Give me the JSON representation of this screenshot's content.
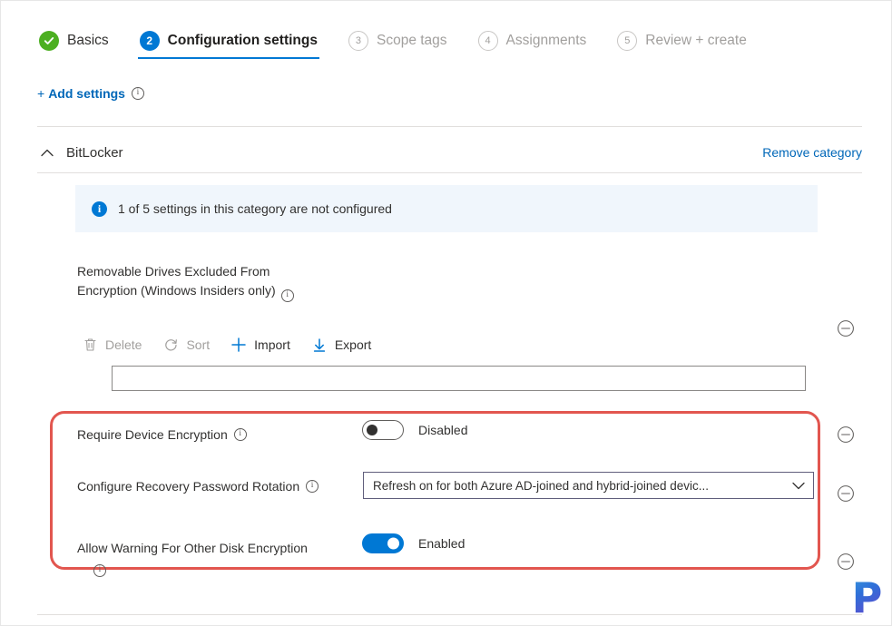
{
  "wizard": {
    "steps": [
      {
        "badge": "check",
        "label": "Basics",
        "state": "done"
      },
      {
        "badge": "2",
        "label": "Configuration settings",
        "state": "active"
      },
      {
        "badge": "3",
        "label": "Scope tags",
        "state": "pending"
      },
      {
        "badge": "4",
        "label": "Assignments",
        "state": "pending"
      },
      {
        "badge": "5",
        "label": "Review + create",
        "state": "pending"
      }
    ]
  },
  "toolbar": {
    "add_settings_plus": "+",
    "add_settings_label": "Add settings"
  },
  "category": {
    "title": "BitLocker",
    "remove_label": "Remove category",
    "banner_text": "1 of 5 settings in this category are not configured",
    "banner_icon": "info-icon"
  },
  "removable_drives": {
    "label_line1": "Removable Drives Excluded From",
    "label_line2": "Encryption (Windows Insiders only)"
  },
  "commandbar": {
    "items": [
      {
        "icon": "trash-icon",
        "label": "Delete",
        "enabled": false
      },
      {
        "icon": "sort-refresh-icon",
        "label": "Sort",
        "enabled": false
      },
      {
        "icon": "plus-icon",
        "label": "Import",
        "enabled": true
      },
      {
        "icon": "download-arrow-icon",
        "label": "Export",
        "enabled": true
      }
    ]
  },
  "list_input": {
    "value": "",
    "placeholder": ""
  },
  "settings": [
    {
      "label": "Require Device Encryption",
      "control": "toggle",
      "state": "off",
      "state_label": "Disabled"
    },
    {
      "label": "Configure Recovery Password Rotation",
      "control": "dropdown",
      "selected": "Refresh on for both Azure AD-joined and hybrid-joined devic..."
    },
    {
      "label": "Allow Warning For Other Disk Encryption",
      "control": "toggle",
      "state": "on",
      "state_label": "Enabled"
    }
  ],
  "remove_icons": {
    "name": "remove-setting-icon",
    "count": 4
  },
  "watermark": {
    "text": "P"
  },
  "colors": {
    "accent": "#0078d4",
    "link": "#0067b8",
    "success": "#4caf21",
    "highlight": "#e2564f",
    "banner_bg": "#f0f6fc",
    "disabled_text": "#a19f9d"
  }
}
